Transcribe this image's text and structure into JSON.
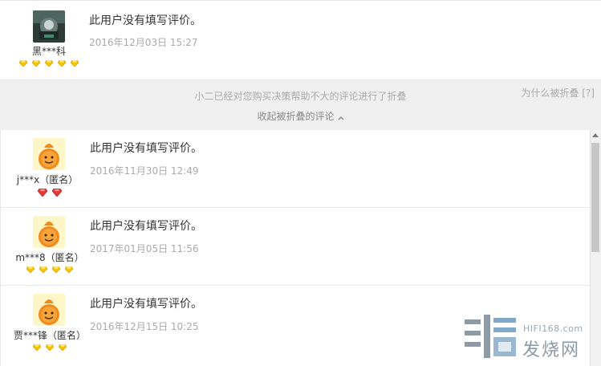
{
  "reviews_top": [
    {
      "username": "黑***科",
      "content": "此用户没有填写评价。",
      "date": "2016年12月03日 15:27",
      "badge_type": "diamond-gold",
      "badge_count": 5
    }
  ],
  "fold": {
    "notice": "小二已经对您购买决策帮助不大的评论进行了折叠",
    "collapse_link": "收起被折叠的评论",
    "why_link": "为什么被折叠 [?]"
  },
  "reviews_folded": [
    {
      "username": "j***x（匿名）",
      "content": "此用户没有填写评价。",
      "date": "2016年11月30日 12:49",
      "badge_type": "heart-red",
      "badge_count": 2
    },
    {
      "username": "m***8（匿名）",
      "content": "此用户没有填写评价。",
      "date": "2017年01月05日 11:56",
      "badge_type": "diamond-gold",
      "badge_count": 4
    },
    {
      "username": "贾***锋（匿名）",
      "content": "此用户没有填写评价。",
      "date": "2016年12月15日 10:25",
      "badge_type": "diamond-gold",
      "badge_count": 3
    }
  ],
  "watermark": {
    "site": "HIFI168.com",
    "name": "发烧网"
  },
  "colors": {
    "fold_bg": "#efefef",
    "date_text": "#aaaaaa",
    "gold_badge": "#f5c400",
    "red_badge": "#e03c3c",
    "avatar_orange": "#f08a1c"
  }
}
